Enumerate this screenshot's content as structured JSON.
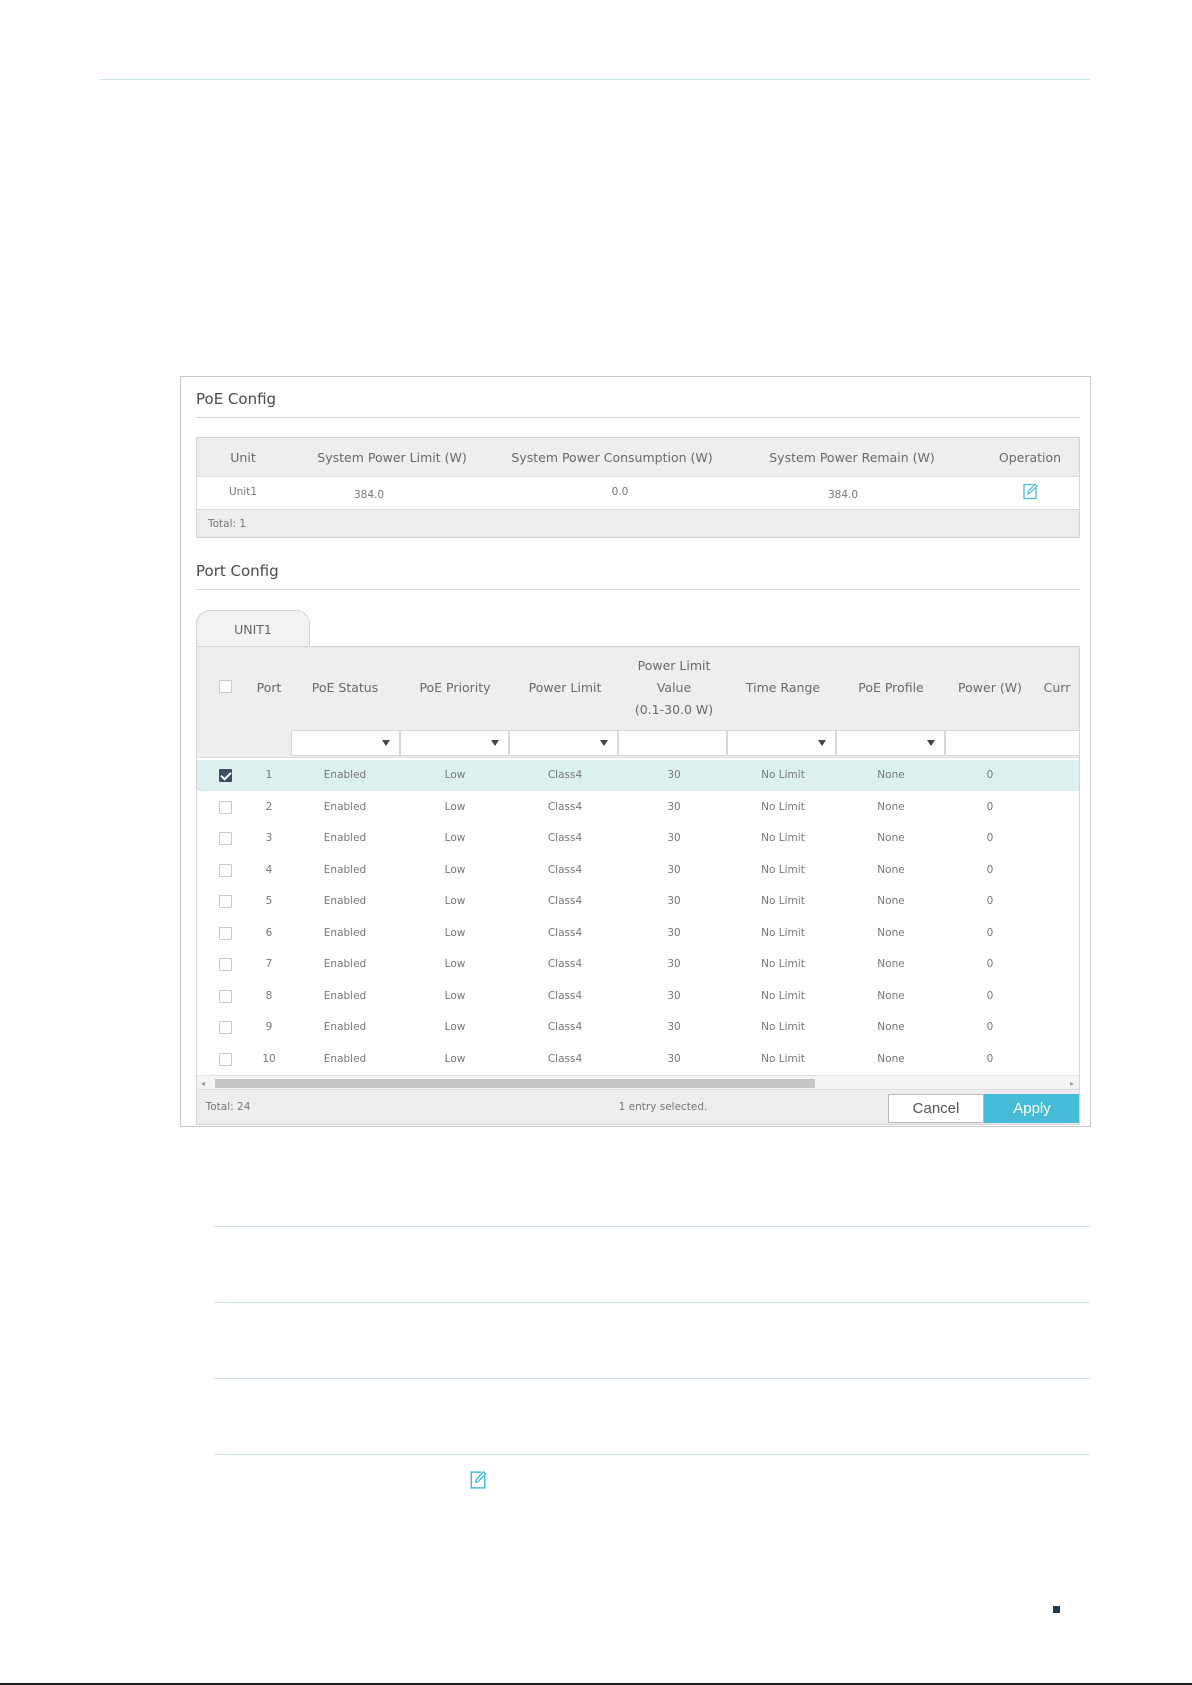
{
  "poe_config": {
    "title": "PoE Config",
    "headers": [
      "Unit",
      "System Power Limit (W)",
      "System Power Consumption (W)",
      "System Power Remain (W)",
      "Operation"
    ],
    "row": {
      "unit": "Unit1",
      "limit": "384.0",
      "consumption": "0.0",
      "remain": "384.0",
      "operation_icon": "edit-icon"
    },
    "total": "Total: 1"
  },
  "port_config": {
    "title": "Port Config",
    "tab": "UNIT1",
    "headers": {
      "port": "Port",
      "poe_status": "PoE Status",
      "poe_priority": "PoE Priority",
      "power_limit": "Power Limit",
      "power_limit_value_1": "Power Limit",
      "power_limit_value_2": "Value",
      "power_limit_value_3": "(0.1-30.0 W)",
      "time_range": "Time Range",
      "poe_profile": "PoE Profile",
      "power": "Power (W)",
      "current": "Curr"
    },
    "rows": [
      {
        "port": "1",
        "status": "Enabled",
        "priority": "Low",
        "limit": "Class4",
        "value": "30",
        "time": "No Limit",
        "profile": "None",
        "power": "0",
        "checked": true
      },
      {
        "port": "2",
        "status": "Enabled",
        "priority": "Low",
        "limit": "Class4",
        "value": "30",
        "time": "No Limit",
        "profile": "None",
        "power": "0",
        "checked": false
      },
      {
        "port": "3",
        "status": "Enabled",
        "priority": "Low",
        "limit": "Class4",
        "value": "30",
        "time": "No Limit",
        "profile": "None",
        "power": "0",
        "checked": false
      },
      {
        "port": "4",
        "status": "Enabled",
        "priority": "Low",
        "limit": "Class4",
        "value": "30",
        "time": "No Limit",
        "profile": "None",
        "power": "0",
        "checked": false
      },
      {
        "port": "5",
        "status": "Enabled",
        "priority": "Low",
        "limit": "Class4",
        "value": "30",
        "time": "No Limit",
        "profile": "None",
        "power": "0",
        "checked": false
      },
      {
        "port": "6",
        "status": "Enabled",
        "priority": "Low",
        "limit": "Class4",
        "value": "30",
        "time": "No Limit",
        "profile": "None",
        "power": "0",
        "checked": false
      },
      {
        "port": "7",
        "status": "Enabled",
        "priority": "Low",
        "limit": "Class4",
        "value": "30",
        "time": "No Limit",
        "profile": "None",
        "power": "0",
        "checked": false
      },
      {
        "port": "8",
        "status": "Enabled",
        "priority": "Low",
        "limit": "Class4",
        "value": "30",
        "time": "No Limit",
        "profile": "None",
        "power": "0",
        "checked": false
      },
      {
        "port": "9",
        "status": "Enabled",
        "priority": "Low",
        "limit": "Class4",
        "value": "30",
        "time": "No Limit",
        "profile": "None",
        "power": "0",
        "checked": false
      },
      {
        "port": "10",
        "status": "Enabled",
        "priority": "Low",
        "limit": "Class4",
        "value": "30",
        "time": "No Limit",
        "profile": "None",
        "power": "0",
        "checked": false
      }
    ],
    "total": "Total: 24",
    "selected": "1 entry selected.",
    "cancel": "Cancel",
    "apply": "Apply"
  },
  "colors": {
    "accent": "#47bcd6",
    "selected_row": "#ddf0f0",
    "checkbox_checked": "#3a4f63"
  }
}
